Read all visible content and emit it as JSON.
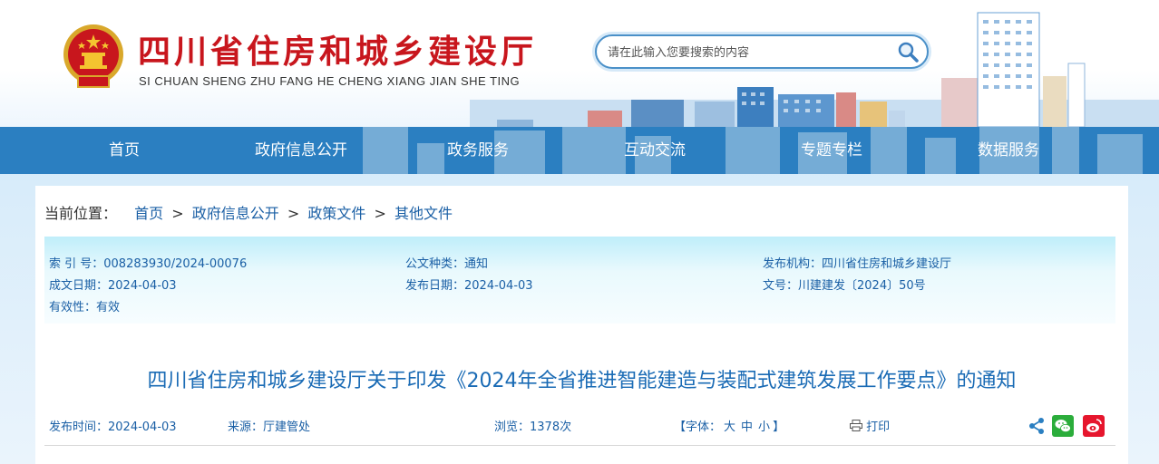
{
  "header": {
    "site_title": "四川省住房和城乡建设厅",
    "site_pinyin": "SI CHUAN SHENG ZHU FANG HE CHENG XIANG JIAN SHE TING",
    "search": {
      "placeholder": "请在此输入您要搜索的内容"
    },
    "emblem_icon": "national-emblem-icon",
    "search_icon": "magnifier-icon"
  },
  "nav": {
    "items": [
      {
        "label": "首页"
      },
      {
        "label": "政府信息公开"
      },
      {
        "label": "政务服务"
      },
      {
        "label": "互动交流"
      },
      {
        "label": "专题专栏"
      },
      {
        "label": "数据服务"
      }
    ]
  },
  "breadcrumb": {
    "lead": "当前位置：",
    "items": [
      "首页",
      "政府信息公开",
      "政策文件",
      "其他文件"
    ],
    "separator": ">"
  },
  "meta": {
    "index_no": {
      "key": "索 引 号：",
      "value": "008283930/2024-00076"
    },
    "doc_type": {
      "key": "公文种类：",
      "value": "通知"
    },
    "issuer": {
      "key": "发布机构：",
      "value": "四川省住房和城乡建设厅"
    },
    "created": {
      "key": "成文日期：",
      "value": "2024-04-03"
    },
    "published": {
      "key": "发布日期：",
      "value": "2024-04-03"
    },
    "doc_no": {
      "key": "文号：",
      "value": "川建建发〔2024〕50号"
    },
    "validity": {
      "key": "有效性：",
      "value": "有效"
    }
  },
  "article": {
    "title": "四川省住房和城乡建设厅关于印发《2024年全省推进智能建造与装配式建筑发展工作要点》的通知",
    "publish_time": {
      "label": "发布时间：",
      "value": "2024-04-03"
    },
    "source": {
      "label": "来源：",
      "value": "厅建管处"
    },
    "views": {
      "label": "浏览：",
      "value": "1378次"
    },
    "font_size": {
      "open": "【字体：",
      "large": "大",
      "medium": "中",
      "small": "小",
      "close": "】"
    },
    "print_label": "打印"
  },
  "colors": {
    "title_red": "#c8161d",
    "nav_blue": "#2b7fc1",
    "link_blue": "#1a5fa5",
    "wechat_green": "#2bad3b",
    "weibo_red": "#e6162d"
  }
}
